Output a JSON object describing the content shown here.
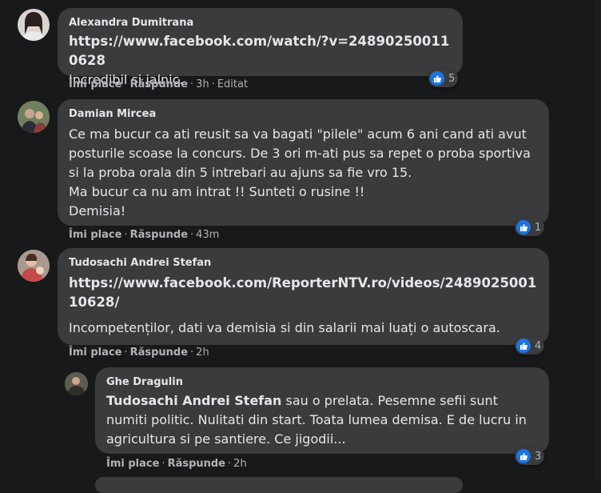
{
  "colors": {
    "background": "#18191a",
    "bubble": "#3a3b3c",
    "like": "#1b74e4",
    "meta": "#b0b3b8"
  },
  "comments": [
    {
      "author": "Alexandra Dumitrana",
      "link": "https://www.facebook.com/watch/?v=248902500110628",
      "text": "Incredibil si jalnic.",
      "like_label": "Îmi place",
      "reply_label": "Răspunde",
      "time": "3h",
      "edited": "Editat",
      "reactions": "5"
    },
    {
      "author": "Damian Mircea",
      "text": "Ce ma bucur ca ati reusit sa va bagati \"pilele\" acum 6 ani cand ati avut posturile scoase la concurs. De 3 ori m-ati pus sa repet o proba sportiva si la proba orala din 5 intrebari au ajuns sa fie vro 15.\nMa bucur ca nu am intrat !! Sunteti o rusine !!\nDemisia!",
      "like_label": "Îmi place",
      "reply_label": "Răspunde",
      "time": "43m",
      "reactions": "1"
    },
    {
      "author": "Tudosachi Andrei Stefan",
      "link": "https://www.facebook.com/ReporterNTV.ro/videos/248902500110628/",
      "text": "Incompetenților, dati va demisia si din salarii mai luați o autoscara.",
      "like_label": "Îmi place",
      "reply_label": "Răspunde",
      "time": "2h",
      "reactions": "4"
    },
    {
      "author": "Ghe Dragulin",
      "mention": "Tudosachi Andrei Stefan",
      "text": " sau o prelata. Pesemne sefii sunt numiti politic. Nulitati din start. Toata lumea demisa. E de lucru in agricultura si pe santiere. Ce jigodii...",
      "like_label": "Îmi place",
      "reply_label": "Răspunde",
      "time": "2h",
      "reactions": "3"
    }
  ]
}
